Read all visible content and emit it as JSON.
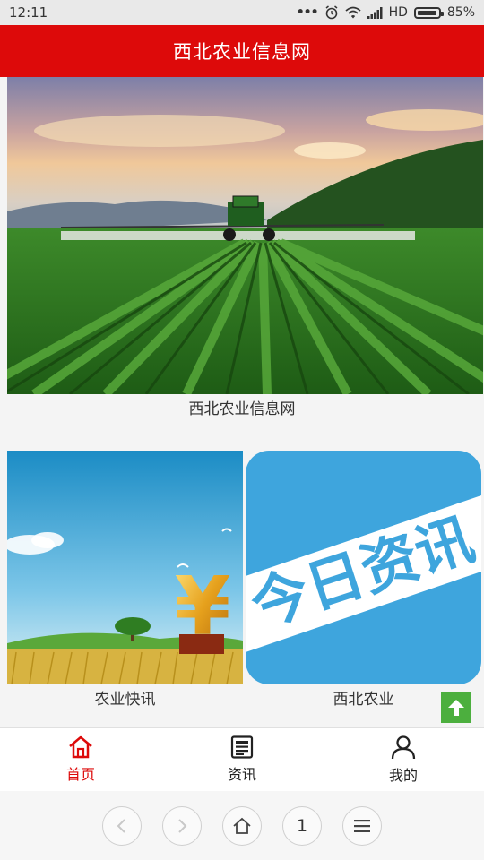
{
  "status_bar": {
    "time": "12:11",
    "signal": "HD",
    "battery": "85%"
  },
  "header": {
    "title": "西北农业信息网"
  },
  "hero": {
    "caption": "西北农业信息网",
    "image": "tractor-spraying-green-field"
  },
  "tiles": [
    {
      "caption": "农业快讯",
      "image": "golden-yuan-sign-wheat-field"
    },
    {
      "caption": "西北农业",
      "image": "today-news-banner",
      "banner_text": "今日资讯"
    }
  ],
  "bottom_nav": [
    {
      "label": "首页",
      "icon": "home-icon",
      "active": true
    },
    {
      "label": "资讯",
      "icon": "news-icon",
      "active": false
    },
    {
      "label": "我的",
      "icon": "user-icon",
      "active": false
    }
  ],
  "browser": {
    "tab_count": "1"
  },
  "colors": {
    "brand_red": "#dd0a0a",
    "accent_green": "#4caf3e",
    "tile_blue": "#3ea5dd"
  }
}
